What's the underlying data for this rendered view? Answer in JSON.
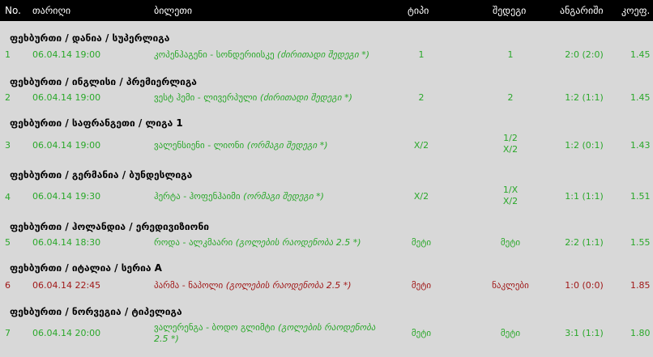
{
  "header": {
    "no": "No.",
    "date": "თარიღი",
    "ticket": "ბილეთი",
    "type": "ტიპი",
    "result": "შედეგი",
    "score": "ანგარიში",
    "coef": "კოეფ."
  },
  "colors": {
    "win": "#2aa82a",
    "lose": "#a01818",
    "header_bg": "#000000",
    "page_bg": "#d8d8d8"
  },
  "rows": [
    {
      "section": "ფეხბურთი / დანია / სუპერლიგა",
      "no": "1",
      "date": "06.04.14 19:00",
      "match": "კოპენჰაგენი - სონდერიისკე",
      "hint": "(ძირითადი შედეგი *)",
      "type": "1",
      "result": "1",
      "score": "2:0 (2:0)",
      "coef": "1.45",
      "status": "win"
    },
    {
      "section": "ფეხბურთი / ინგლისი / პრემიერლიგა",
      "no": "2",
      "date": "06.04.14 19:00",
      "match": "ვესტ ჰემი - ლივერპული",
      "hint": "(ძირითადი შედეგი *)",
      "type": "2",
      "result": "2",
      "score": "1:2 (1:1)",
      "coef": "1.45",
      "status": "win"
    },
    {
      "section": "ფეხბურთი / საფრანგეთი / ლიგა 1",
      "no": "3",
      "date": "06.04.14 19:00",
      "match": "ვალენსიენი - ლიონი",
      "hint": "(ორმაგი შედეგი *)",
      "type": "X/2",
      "result_1": "1/2",
      "result_2": "X/2",
      "score": "1:2 (0:1)",
      "coef": "1.43",
      "status": "win"
    },
    {
      "section": "ფეხბურთი / გერმანია / ბუნდესლიგა",
      "no": "4",
      "date": "06.04.14 19:30",
      "match": "ჰერტა - ჰოფენჰაიმი",
      "hint": "(ორმაგი შედეგი *)",
      "type": "X/2",
      "result_1": "1/X",
      "result_2": "X/2",
      "score": "1:1 (1:1)",
      "coef": "1.51",
      "status": "win"
    },
    {
      "section": "ფეხბურთი / ჰოლანდია / ერედივიზიონი",
      "no": "5",
      "date": "06.04.14 18:30",
      "match": "როდა - ალკმაარი",
      "hint": "(გოლების რაოდენობა 2.5 *)",
      "type": "მეტი",
      "result": "მეტი",
      "score": "2:2 (1:1)",
      "coef": "1.55",
      "status": "win"
    },
    {
      "section": "ფეხბურთი / იტალია / სერია A",
      "no": "6",
      "date": "06.04.14 22:45",
      "match": "პარმა - ნაპოლი",
      "hint": "(გოლების რაოდენობა 2.5 *)",
      "type": "მეტი",
      "result": "ნაკლები",
      "score": "1:0 (0:0)",
      "coef": "1.85",
      "status": "lose"
    },
    {
      "section": "ფეხბურთი / ნორვეგია / ტიპელიგა",
      "no": "7",
      "date": "06.04.14 20:00",
      "match": "ვალერენგა - ბოდო გლიმტი",
      "hint": "(გოლების რაოდენობა",
      "hint_2": "2.5 *)",
      "type": "მეტი",
      "result": "მეტი",
      "score": "3:1 (1:1)",
      "coef": "1.80",
      "status": "win"
    }
  ]
}
